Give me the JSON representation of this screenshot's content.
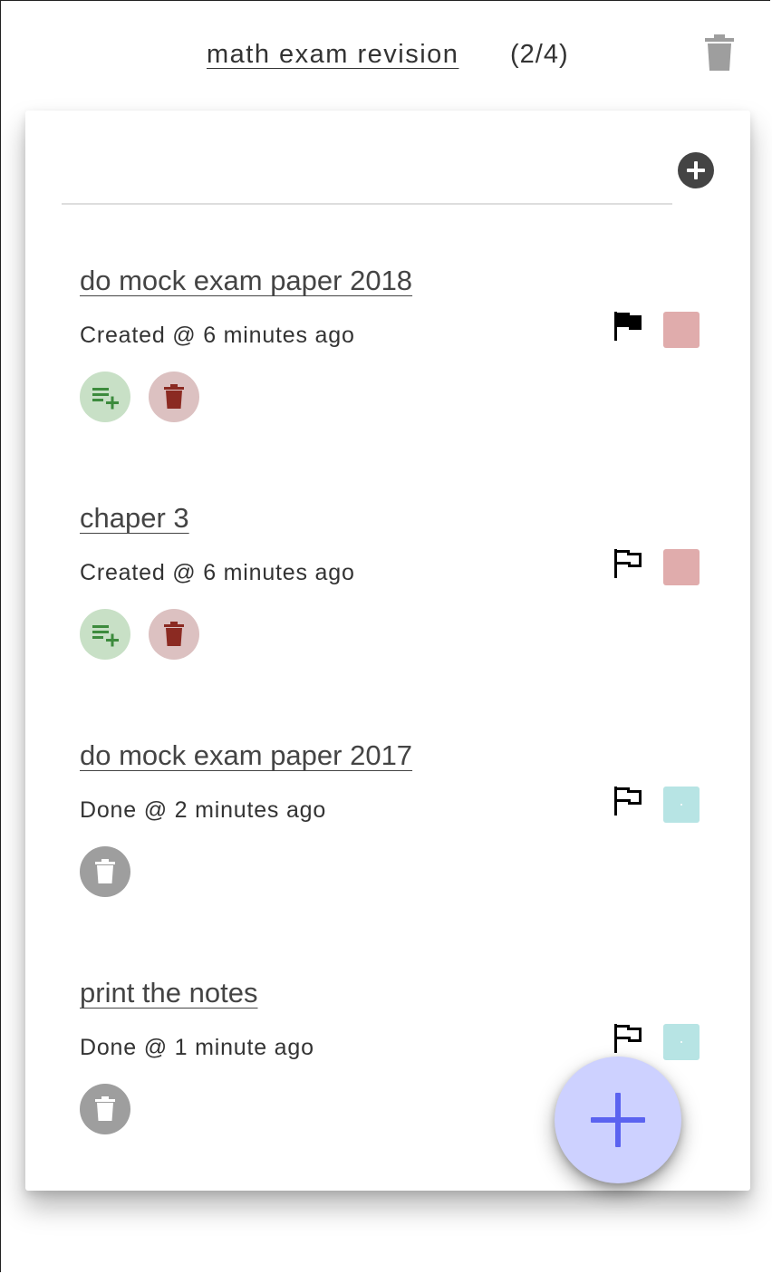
{
  "header": {
    "title": "math exam revision",
    "count": "(2/4)",
    "trash_icon": "trash-icon"
  },
  "new_task": {
    "value": "",
    "placeholder": "",
    "add_icon": "add-circle-icon"
  },
  "tasks": [
    {
      "title": "do mock exam paper 2018",
      "status": "Created @ 6 minutes ago",
      "flagged": true,
      "color": "#e0acac",
      "done": false
    },
    {
      "title": "chaper 3",
      "status": "Created @ 6 minutes ago",
      "flagged": false,
      "color": "#e0acac",
      "done": false
    },
    {
      "title": "do mock exam paper 2017",
      "status": "Done @ 2 minutes ago",
      "flagged": false,
      "color": "#b7e4e4",
      "done": true
    },
    {
      "title": "print the notes",
      "status": "Done @ 1 minute ago",
      "flagged": false,
      "color": "#b7e4e4",
      "done": true
    }
  ],
  "colors": {
    "add_button_bg": "#c8e0c6",
    "add_button_icon": "#3d8b3d",
    "delete_button_bg": "#dcc1c1",
    "delete_button_icon": "#8b2a22",
    "done_delete_bg": "#9e9e9e",
    "fab_bg": "#cdd1ff",
    "fab_icon": "#5b63f0"
  },
  "fab": {
    "icon": "plus-icon"
  }
}
